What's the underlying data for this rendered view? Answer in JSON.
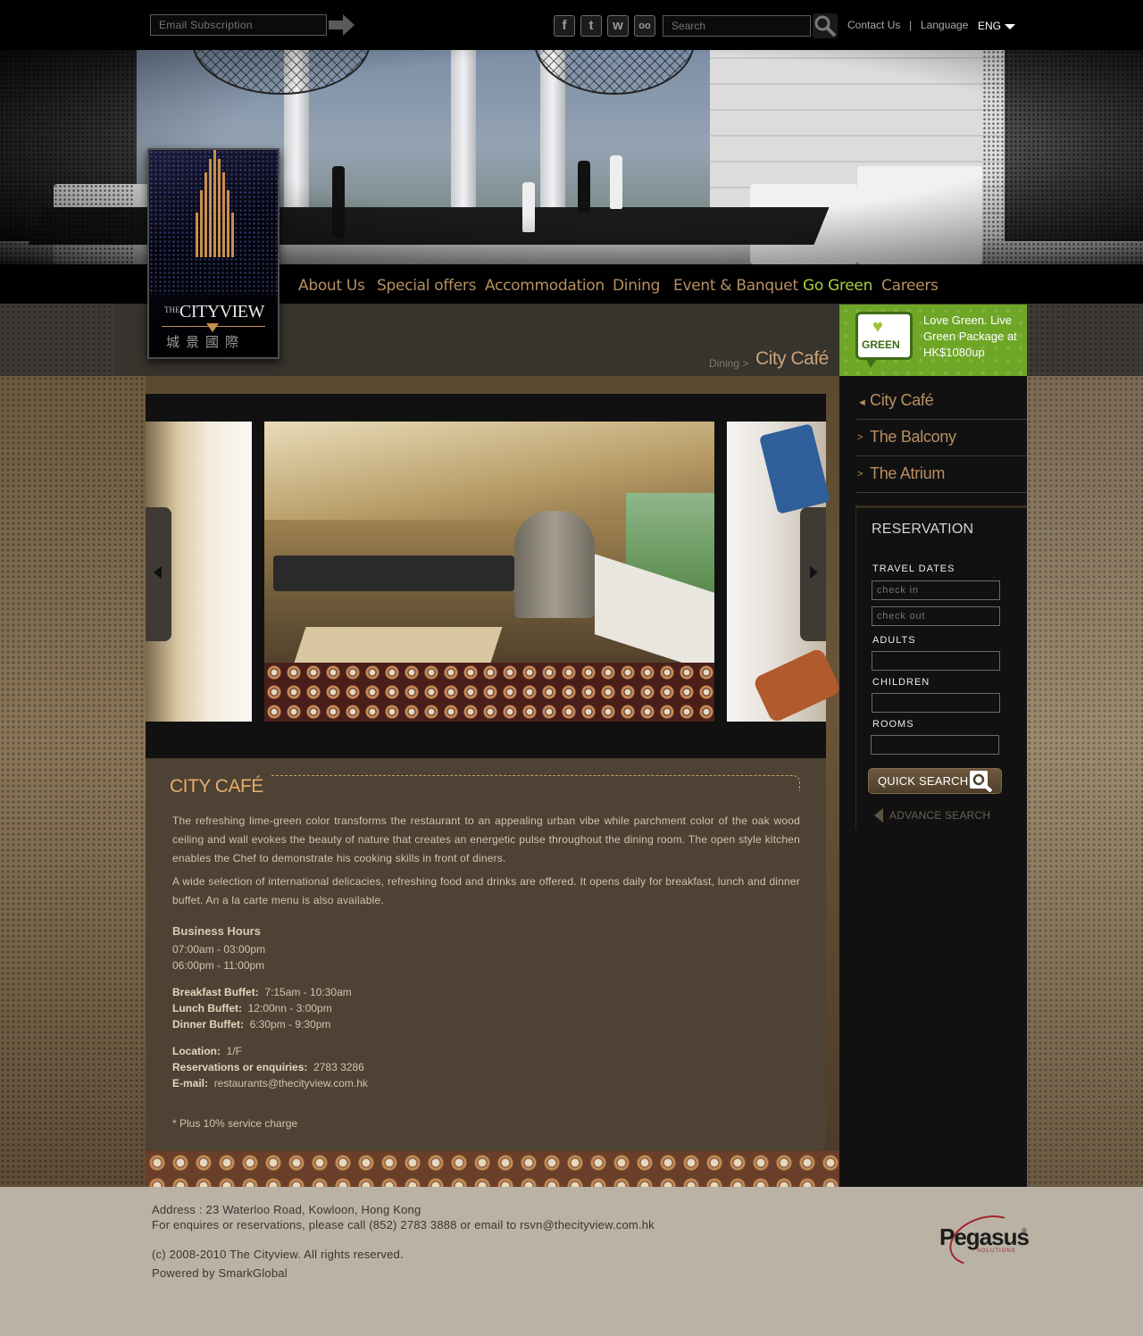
{
  "topbar": {
    "email_placeholder": "Email Subscription",
    "search_placeholder": "Search",
    "social": [
      {
        "icon": "facebook-icon",
        "glyph": "f"
      },
      {
        "icon": "twitter-icon",
        "glyph": "t"
      },
      {
        "icon": "weibo-icon",
        "glyph": "w"
      },
      {
        "icon": "tripadvisor-icon",
        "glyph": "oo"
      }
    ],
    "contact_label": "Contact Us",
    "separator": "|",
    "language_label": "Language",
    "language_value": "ENG"
  },
  "logo": {
    "the": "THE",
    "name": "CITYVIEW",
    "chinese": "城景國際"
  },
  "nav": {
    "items": [
      {
        "label": "About Us"
      },
      {
        "label": "Special offers"
      },
      {
        "label": "Accommodation"
      },
      {
        "label": "Dining"
      },
      {
        "label": "Event & Banquet"
      },
      {
        "label": "Go Green"
      },
      {
        "label": "Careers"
      }
    ]
  },
  "breadcrumb": {
    "parent": "Dining >",
    "current": "City Café"
  },
  "green_banner": {
    "badge": "GREEN",
    "text": "Love Green. Live Green Package at HK$1080up"
  },
  "content": {
    "title": "CITY CAFÉ",
    "paragraph_1": "The refreshing lime-green color transforms the restaurant to an appealing urban vibe while parchment color of the oak wood ceiling and wall evokes the beauty of nature that creates an energetic pulse throughout the dining room. The open style kitchen enables the Chef to demonstrate his cooking skills in front of diners.",
    "paragraph_2": "A wide selection of international delicacies, refreshing food and drinks are offered. It opens daily for breakfast, lunch and dinner buffet. An a la carte menu is also available.",
    "hours_heading": "Business Hours",
    "hours": [
      "07:00am - 03:00pm",
      "06:00pm - 11:00pm"
    ],
    "buffets": [
      {
        "label": "Breakfast Buffet:",
        "value": "7:15am - 10:30am"
      },
      {
        "label": "Lunch Buffet:",
        "value": "12:00nn - 3:00pm"
      },
      {
        "label": "Dinner Buffet:",
        "value": "6:30pm - 9:30pm"
      }
    ],
    "info": [
      {
        "label": "Location:",
        "value": "1/F"
      },
      {
        "label": "Reservations or enquiries:",
        "value": "2783 3286"
      },
      {
        "label": "E-mail:",
        "value": "restaurants@thecityview.com.hk"
      }
    ],
    "note": "* Plus 10% service charge"
  },
  "sidebar": {
    "restaurants": [
      {
        "arrow": "◄",
        "label": "City Café"
      },
      {
        "arrow": ">",
        "label": "The Balcony"
      },
      {
        "arrow": ">",
        "label": "The Atrium"
      }
    ],
    "reservation": {
      "title": "RESERVATION",
      "travel_dates_label": "TRAVEL DATES",
      "check_in_placeholder": "check in",
      "check_out_placeholder": "check out",
      "adults_label": "ADULTS",
      "children_label": "CHILDREN",
      "rooms_label": "ROOMS",
      "quick_search_label": "QUICK SEARCH",
      "advance_search_label": "ADVANCE SEARCH"
    }
  },
  "footer": {
    "address": "Address : 23 Waterloo Road, Kowloon, Hong Kong",
    "enquiries": "For enquires or reservations, please call (852) 2783 3888 or email to rsvn@thecityview.com.hk",
    "copyright": "(c) 2008-2010 The Cityview. All rights reserved.",
    "powered": "Powered by SmarkGlobal",
    "partner_logo": "Pegasus",
    "partner_reg": "®",
    "partner_sub": "SOLUTIONS"
  },
  "colors": {
    "nav_text": "#b78f62",
    "nav_active_green": "#a8cf3e",
    "title_orange": "#e6ad6a",
    "panel_bg": "#4d4234",
    "green_banner": "#6ea626"
  }
}
